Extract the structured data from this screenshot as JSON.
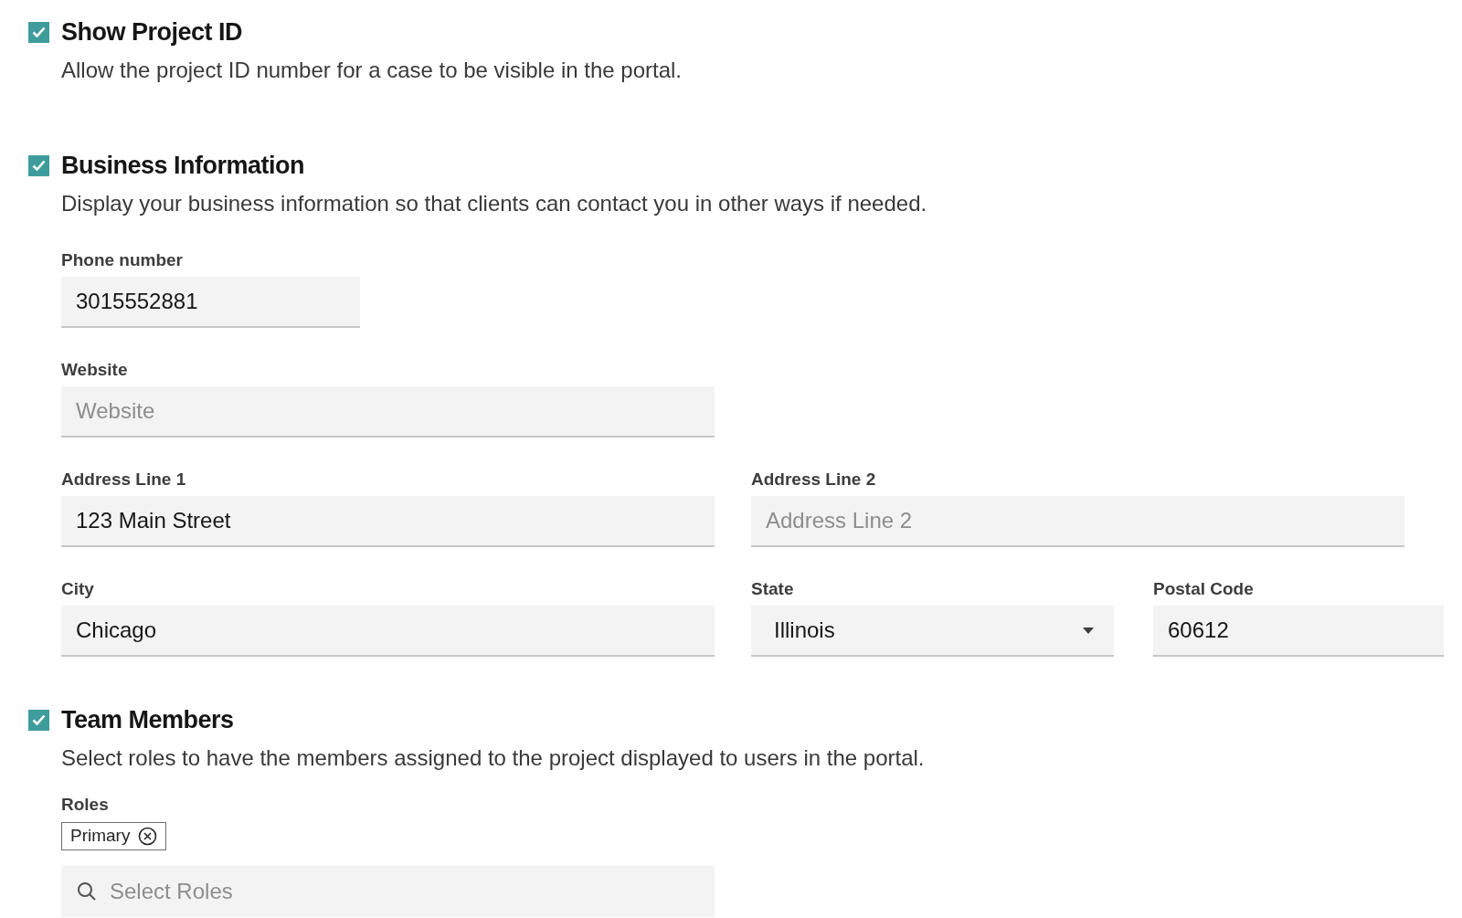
{
  "sections": [
    {
      "title": "Show Project ID",
      "checked": true,
      "description": "Allow the project ID number for a case to be visible in the portal."
    },
    {
      "title": "Business Information",
      "checked": true,
      "description": "Display your business information so that clients can contact you in other ways if needed.",
      "rows": [
        [
          {
            "kind": "text",
            "label": "Phone number",
            "value": "3015552881"
          }
        ],
        [
          {
            "kind": "text",
            "label": "Website",
            "placeholder": "Website"
          }
        ],
        [
          {
            "kind": "text",
            "label": "Address Line 1",
            "value": "123 Main Street"
          },
          {
            "kind": "text",
            "label": "Address Line 2",
            "placeholder": "Address Line 2"
          }
        ],
        [
          {
            "kind": "text",
            "label": "City",
            "value": "Chicago"
          },
          {
            "kind": "select",
            "label": "State",
            "value": "Illinois"
          },
          {
            "kind": "text",
            "label": "Postal Code",
            "value": "60612"
          }
        ]
      ]
    },
    {
      "title": "Team Members",
      "checked": true,
      "description": "Select roles to have the members assigned to the project displayed to users in the portal.",
      "roles": {
        "label": "Roles",
        "tags": [
          {
            "label": "Primary"
          }
        ],
        "placeholder": "Select Roles"
      }
    }
  ]
}
